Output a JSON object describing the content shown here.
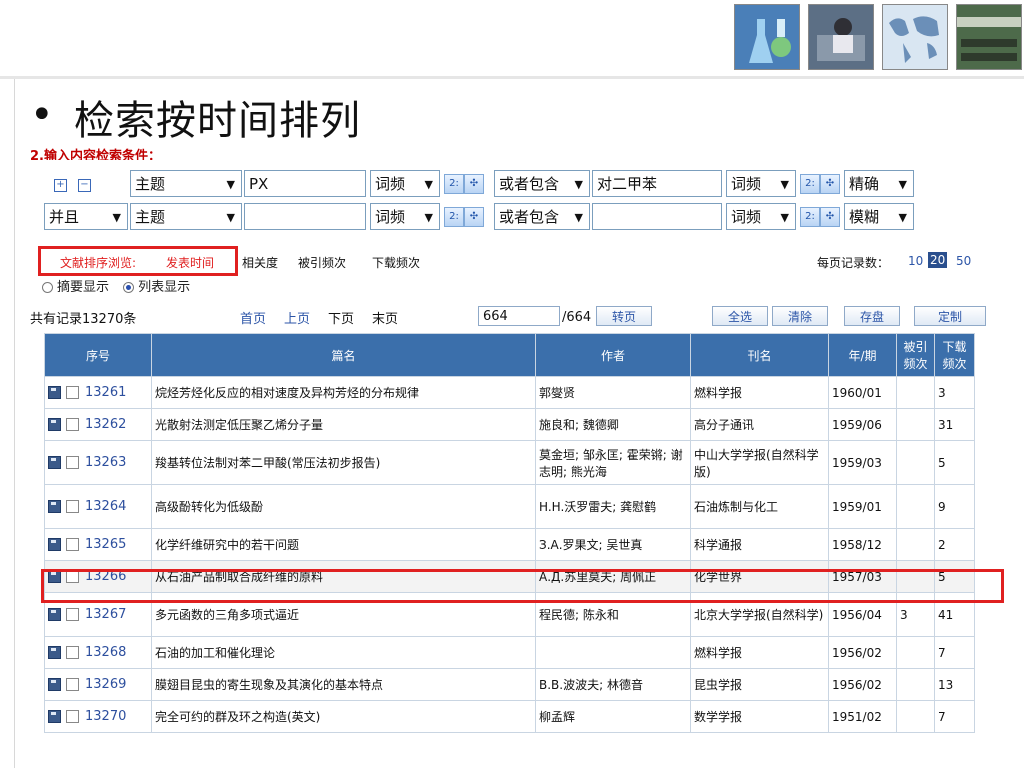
{
  "slide": {
    "title": "检索按时间排列",
    "bullet": "•"
  },
  "search": {
    "header": "2.输入内容检索条件：",
    "rows": [
      {
        "logic": "",
        "field": "主题",
        "value": "PX",
        "freq": "词频",
        "connector": "或者包含",
        "value2": "对二甲苯",
        "freq2": "词频",
        "match": "精确"
      },
      {
        "logic": "并且",
        "field": "主题",
        "value": "",
        "freq": "词频",
        "connector": "或者包含",
        "value2": "",
        "freq2": "词频",
        "match": "模糊"
      }
    ]
  },
  "sort_bar": {
    "label": "文献排序浏览:",
    "options": [
      "发表时间",
      "相关度",
      "被引频次",
      "下载频次"
    ],
    "per_page_label": "每页记录数：",
    "per_page": [
      "10",
      "20",
      "50"
    ],
    "per_page_active": "20"
  },
  "view_bar": {
    "summary": "摘要显示",
    "list": "列表显示"
  },
  "page_bar": {
    "total": "共有记录13270条",
    "first": "首页",
    "prev": "上页",
    "next": "下页",
    "last": "末页",
    "page_value": "664",
    "page_total": "/664",
    "go": "转页",
    "select_all": "全选",
    "clear": "清除",
    "save": "存盘",
    "custom": "定制"
  },
  "table": {
    "headers": [
      "序号",
      "篇名",
      "作者",
      "刊名",
      "年/期",
      "被引频次",
      "下载频次"
    ],
    "rows": [
      {
        "id": "13261",
        "title": "烷烃芳烃化反应的相对速度及异构芳烃的分布规律",
        "author": "郭燮贤",
        "journal": "燃料学报",
        "journal_color": "normal",
        "date": "1960/01",
        "cited": "",
        "downloads": "3"
      },
      {
        "id": "13262",
        "title": "光散射法测定低压聚乙烯分子量",
        "author": "施良和; 魏德卿",
        "journal": "高分子通讯",
        "journal_color": "pink",
        "date": "1959/06",
        "cited": "",
        "downloads": "31"
      },
      {
        "id": "13263",
        "title": "羧基转位法制对苯二甲酸(常压法初步报告)",
        "author": "莫金垣; 邹永匡; 霍荣锵; 谢志明; 熊光海",
        "journal": "中山大学学报(自然科学版)",
        "journal_color": "normal",
        "date": "1959/03",
        "cited": "",
        "downloads": "5"
      },
      {
        "id": "13264",
        "title": "高级酚转化为低级酚",
        "author": "H.H.沃罗雷夫; 龚慰鹤",
        "journal": "石油炼制与化工",
        "journal_color": "normal",
        "date": "1959/01",
        "cited": "",
        "downloads": "9"
      },
      {
        "id": "13265",
        "title": "化学纤维研究中的若干问题",
        "author": "З.А.罗果文; 吴世真",
        "journal": "科学通报",
        "journal_color": "pink",
        "date": "1958/12",
        "cited": "",
        "downloads": "2"
      },
      {
        "id": "13266",
        "title": "从石油产品制取合成纤维的原料",
        "author": "А.Д.苏里莫夫; 周佩正",
        "journal": "化学世界",
        "journal_color": "normal",
        "date": "1957/03",
        "cited": "",
        "downloads": "5"
      },
      {
        "id": "13267",
        "title": "多元函数的三角多项式逼近",
        "author": "程民德; 陈永和",
        "journal": "北京大学学报(自然科学)",
        "journal_color": "pink",
        "date": "1956/04",
        "cited": "3",
        "downloads": "41"
      },
      {
        "id": "13268",
        "title": "石油的加工和催化理论",
        "author": "",
        "journal": "燃料学报",
        "journal_color": "normal",
        "date": "1956/02",
        "cited": "",
        "downloads": "7"
      },
      {
        "id": "13269",
        "title": "膜翅目昆虫的寄生现象及其演化的基本特点",
        "author": "B.B.波波夫; 林德音",
        "journal": "昆虫学报",
        "journal_color": "pink",
        "date": "1956/02",
        "cited": "",
        "downloads": "13"
      },
      {
        "id": "13270",
        "title": "完全可约的群及环之构造(英文)",
        "author": "柳孟辉",
        "journal": "数学学报",
        "journal_color": "pink",
        "date": "1951/02",
        "cited": "",
        "downloads": "7"
      }
    ]
  },
  "colors": {
    "header_bg": "#3b6fab",
    "highlight_box": "#e02020",
    "pink_link": "#cc1a9a",
    "sort_red": "#e02020"
  },
  "icons": [
    "lab-photo-icon",
    "office-photo-icon",
    "world-map-icon",
    "classroom-photo-icon"
  ]
}
